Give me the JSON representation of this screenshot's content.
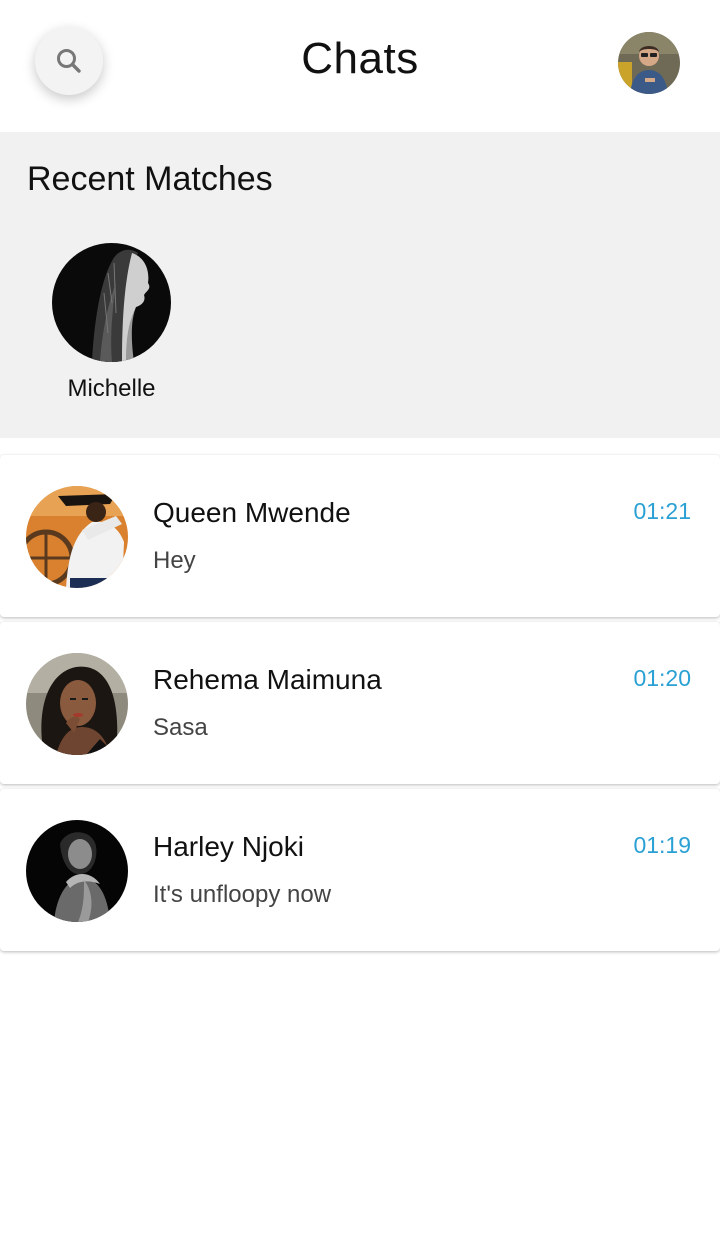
{
  "header": {
    "title": "Chats",
    "search_icon": "search-icon",
    "profile_icon": "profile-avatar"
  },
  "recent_matches": {
    "title": "Recent Matches",
    "items": [
      {
        "name": "Michelle"
      }
    ]
  },
  "chats": [
    {
      "name": "Queen Mwende",
      "message": "Hey",
      "time": "01:21"
    },
    {
      "name": "Rehema Maimuna",
      "message": "Sasa",
      "time": "01:20"
    },
    {
      "name": "Harley Njoki",
      "message": "It's unfloopy now",
      "time": "01:19"
    }
  ],
  "colors": {
    "accent_time": "#2aa0d4",
    "section_bg": "#f1f1f1"
  }
}
